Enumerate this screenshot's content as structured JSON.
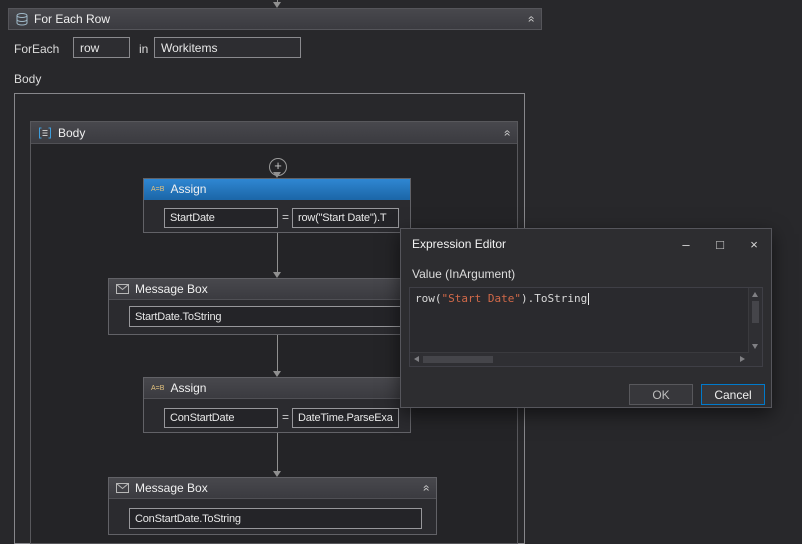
{
  "colors": {
    "selection_blue": "#1f78c8",
    "string_red": "#d16949",
    "focus_border": "#007acc",
    "background": "#28282b"
  },
  "icons": {
    "plus": "+",
    "collapse": "»",
    "assign": "A=B",
    "equals": "=",
    "minimize": "–",
    "maximize": "□",
    "close": "×"
  },
  "for_each_row": {
    "title": "For Each Row",
    "foreach_label": "ForEach",
    "foreach_value": "row",
    "in_label": "in",
    "in_value": "Workitems",
    "body_label": "Body"
  },
  "body_sequence": {
    "title": "Body"
  },
  "activities": {
    "assign1": {
      "title": "Assign",
      "to": "StartDate",
      "value": "row(\"Start Date\").T"
    },
    "message1": {
      "title": "Message Box",
      "text": "StartDate.ToString"
    },
    "assign2": {
      "title": "Assign",
      "to": "ConStartDate",
      "value": "DateTime.ParseExa"
    },
    "message2": {
      "title": "Message Box",
      "text": "ConStartDate.ToString"
    }
  },
  "expression_editor": {
    "title": "Expression Editor",
    "value_label": "Value (InArgument)",
    "expr_prefix": "row(",
    "expr_string": "\"Start Date\"",
    "expr_suffix": ").ToString",
    "ok_label": "OK",
    "cancel_label": "Cancel"
  }
}
